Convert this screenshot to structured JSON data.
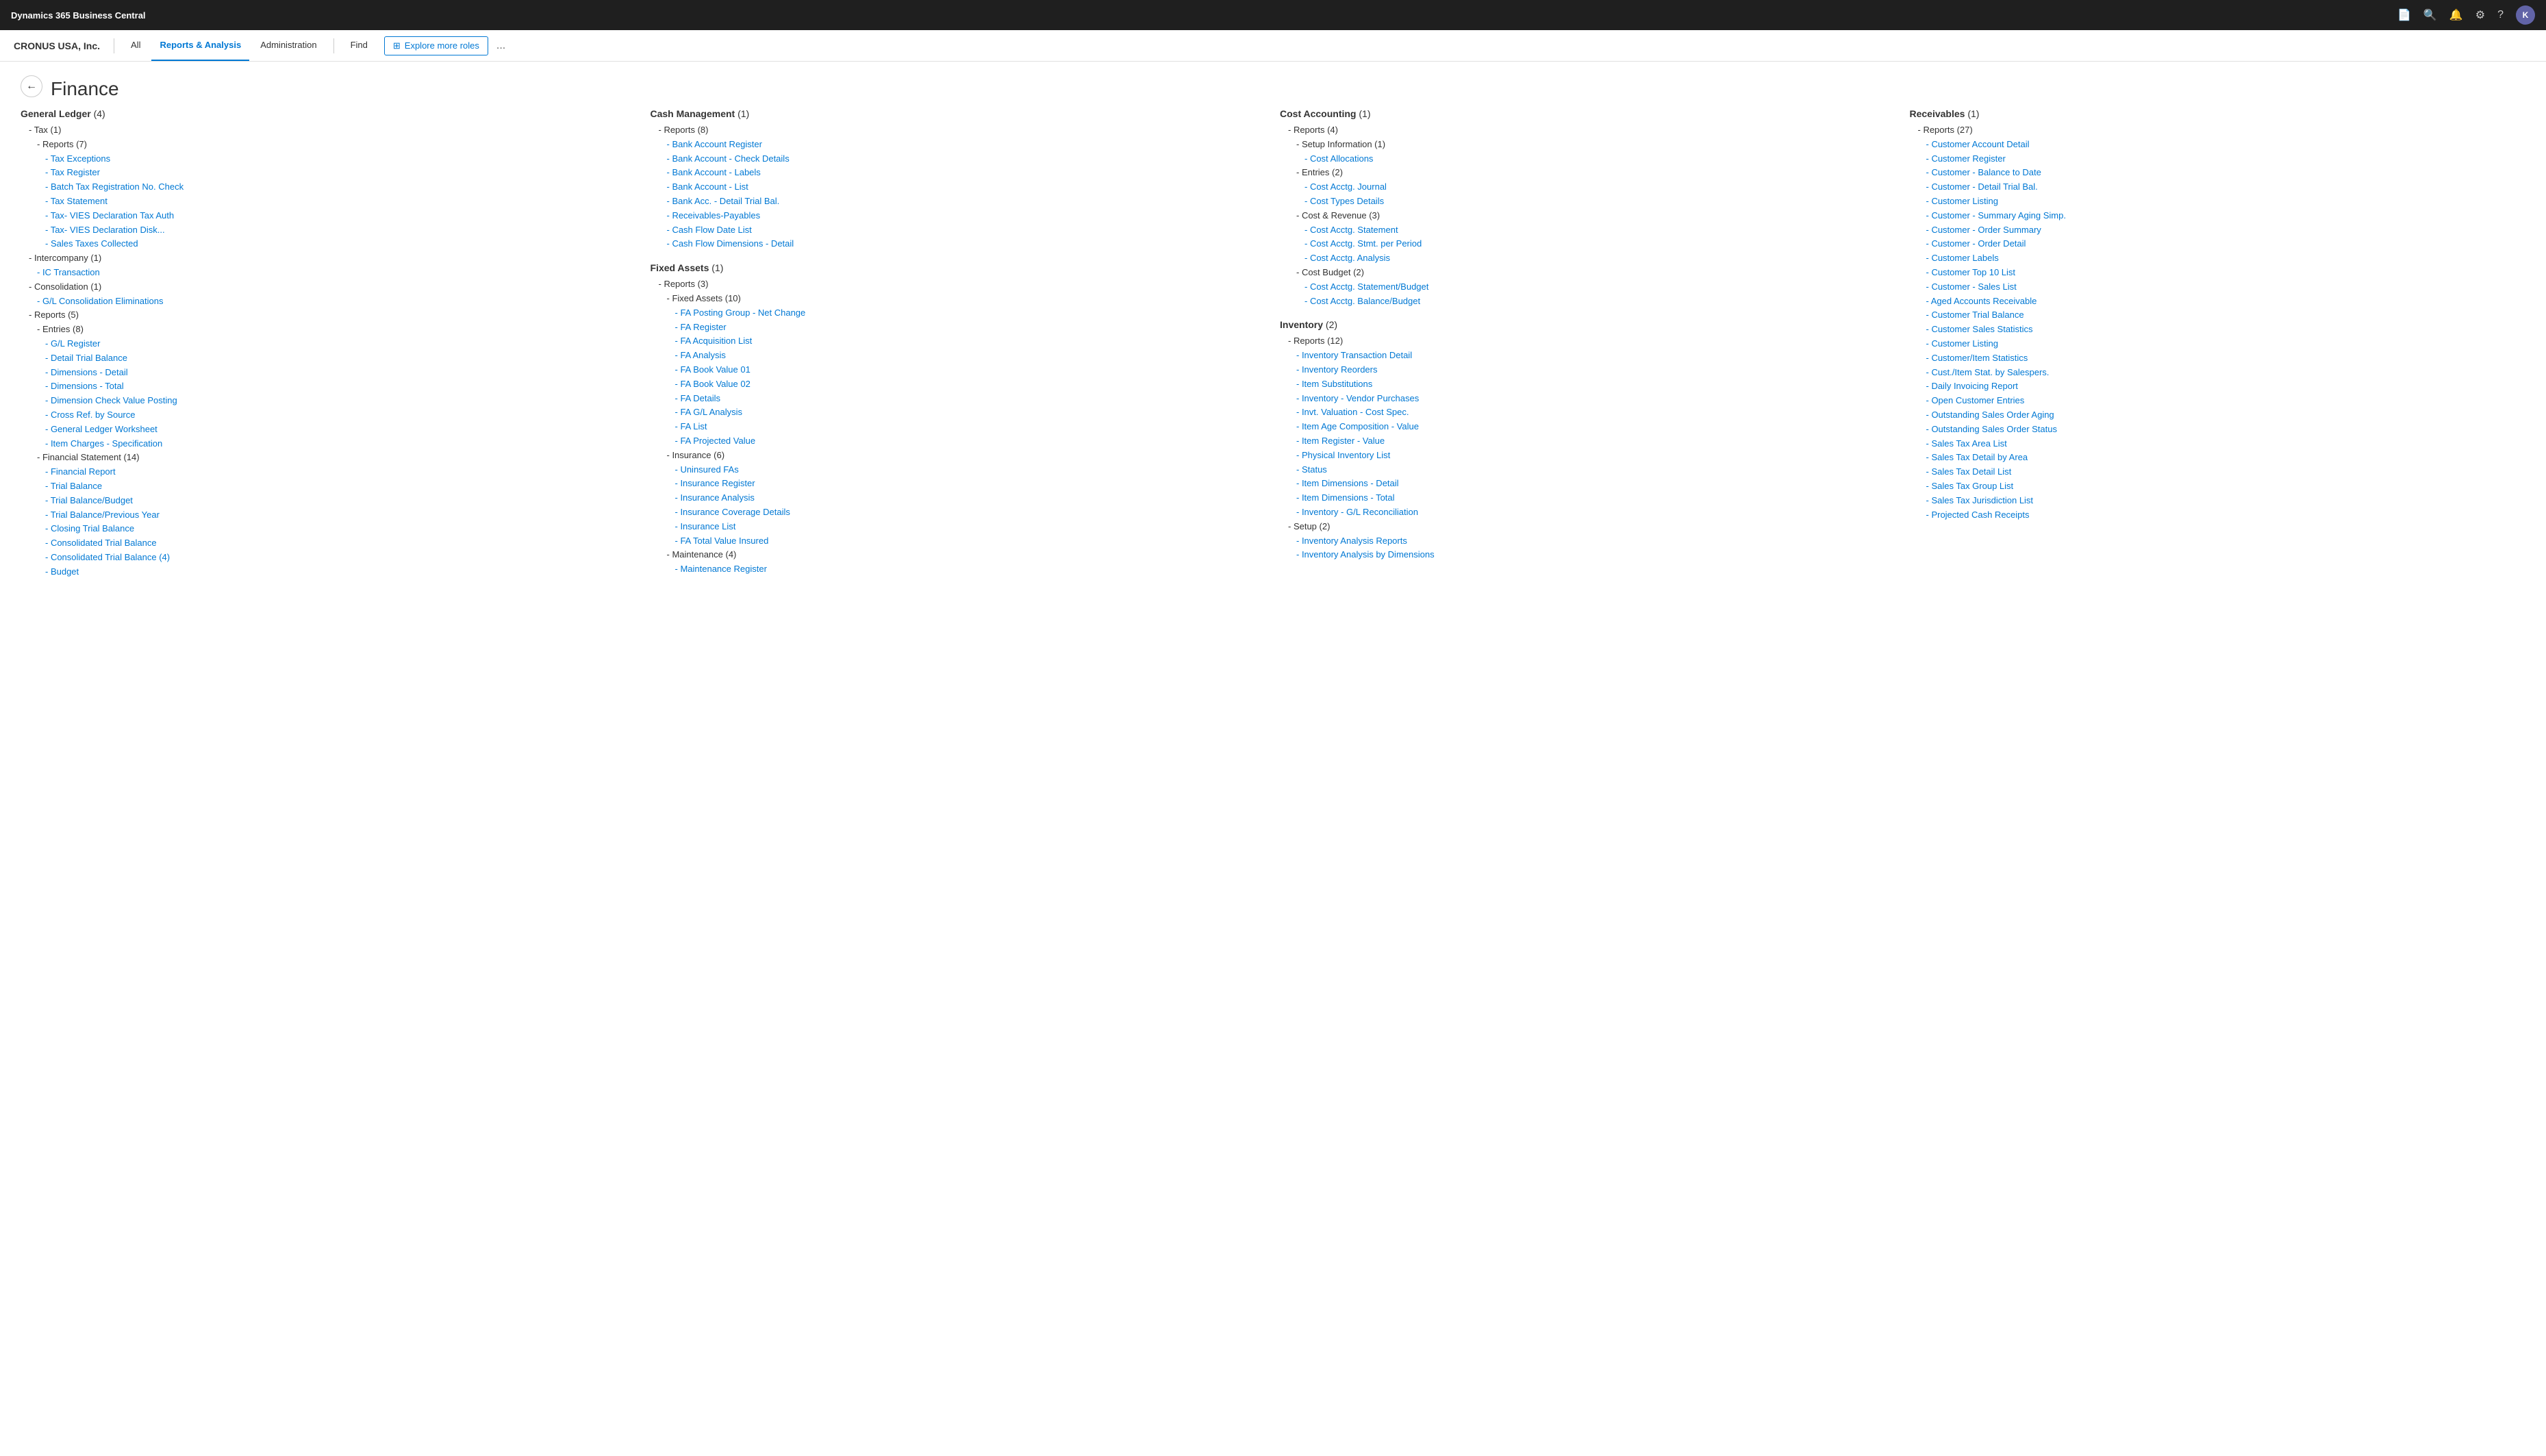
{
  "topbar": {
    "logo": "Dynamics 365 Business Central",
    "avatar_letter": "K"
  },
  "navbar": {
    "company": "CRONUS USA, Inc.",
    "tabs": [
      "All",
      "Reports & Analysis",
      "Administration",
      "Find"
    ],
    "active_tab": "Reports & Analysis",
    "explore_btn": "Explore more roles",
    "more_btn": "..."
  },
  "page": {
    "title": "Finance",
    "back_label": "←"
  },
  "columns": [
    {
      "id": "general-ledger",
      "title": "General Ledger",
      "count": "(4)",
      "items": [
        {
          "level": 1,
          "text": "- Tax (1)",
          "link": false
        },
        {
          "level": 2,
          "text": "- Reports (7)",
          "link": false
        },
        {
          "level": 3,
          "text": "- Tax Exceptions",
          "link": true
        },
        {
          "level": 3,
          "text": "- Tax Register",
          "link": true
        },
        {
          "level": 3,
          "text": "- Batch Tax Registration No. Check",
          "link": true
        },
        {
          "level": 3,
          "text": "- Tax Statement",
          "link": true
        },
        {
          "level": 3,
          "text": "- Tax- VIES Declaration Tax Auth",
          "link": true
        },
        {
          "level": 3,
          "text": "- Tax- VIES Declaration Disk...",
          "link": true
        },
        {
          "level": 3,
          "text": "- Sales Taxes Collected",
          "link": true
        },
        {
          "level": 1,
          "text": "- Intercompany (1)",
          "link": false
        },
        {
          "level": 2,
          "text": "- IC Transaction",
          "link": true
        },
        {
          "level": 1,
          "text": "- Consolidation (1)",
          "link": false
        },
        {
          "level": 2,
          "text": "- G/L Consolidation Eliminations",
          "link": true
        },
        {
          "level": 1,
          "text": "- Reports (5)",
          "link": false
        },
        {
          "level": 2,
          "text": "- Entries (8)",
          "link": false
        },
        {
          "level": 3,
          "text": "- G/L Register",
          "link": true
        },
        {
          "level": 3,
          "text": "- Detail Trial Balance",
          "link": true
        },
        {
          "level": 3,
          "text": "- Dimensions - Detail",
          "link": true
        },
        {
          "level": 3,
          "text": "- Dimensions - Total",
          "link": true
        },
        {
          "level": 3,
          "text": "- Dimension Check Value Posting",
          "link": true
        },
        {
          "level": 3,
          "text": "- Cross Ref. by Source",
          "link": true
        },
        {
          "level": 3,
          "text": "- General Ledger Worksheet",
          "link": true
        },
        {
          "level": 3,
          "text": "- Item Charges - Specification",
          "link": true
        },
        {
          "level": 2,
          "text": "- Financial Statement (14)",
          "link": false
        },
        {
          "level": 3,
          "text": "- Financial Report",
          "link": true
        },
        {
          "level": 3,
          "text": "- Trial Balance",
          "link": true
        },
        {
          "level": 3,
          "text": "- Trial Balance/Budget",
          "link": true
        },
        {
          "level": 3,
          "text": "- Trial Balance/Previous Year",
          "link": true
        },
        {
          "level": 3,
          "text": "- Closing Trial Balance",
          "link": true
        },
        {
          "level": 3,
          "text": "- Consolidated Trial Balance",
          "link": true
        },
        {
          "level": 3,
          "text": "- Consolidated Trial Balance (4)",
          "link": true
        },
        {
          "level": 3,
          "text": "- Budget",
          "link": true
        }
      ]
    },
    {
      "id": "cash-management",
      "title": "Cash Management",
      "count": "(1)",
      "items": [
        {
          "level": 1,
          "text": "- Reports (8)",
          "link": false
        },
        {
          "level": 2,
          "text": "- Bank Account Register",
          "link": true
        },
        {
          "level": 2,
          "text": "- Bank Account - Check Details",
          "link": true
        },
        {
          "level": 2,
          "text": "- Bank Account - Labels",
          "link": true
        },
        {
          "level": 2,
          "text": "- Bank Account - List",
          "link": true
        },
        {
          "level": 2,
          "text": "- Bank Acc. - Detail Trial Bal.",
          "link": true
        },
        {
          "level": 2,
          "text": "- Receivables-Payables",
          "link": true
        },
        {
          "level": 2,
          "text": "- Cash Flow Date List",
          "link": true
        },
        {
          "level": 2,
          "text": "- Cash Flow Dimensions - Detail",
          "link": true
        },
        {
          "level": 0,
          "text": "",
          "link": false
        },
        {
          "level": 0,
          "text": "Fixed Assets (1)",
          "link": false,
          "section": true
        },
        {
          "level": 1,
          "text": "- Reports (3)",
          "link": false
        },
        {
          "level": 2,
          "text": "- Fixed Assets (10)",
          "link": false
        },
        {
          "level": 3,
          "text": "- FA Posting Group - Net Change",
          "link": true
        },
        {
          "level": 3,
          "text": "- FA Register",
          "link": true
        },
        {
          "level": 3,
          "text": "- FA Acquisition List",
          "link": true
        },
        {
          "level": 3,
          "text": "- FA Analysis",
          "link": true
        },
        {
          "level": 3,
          "text": "- FA Book Value 01",
          "link": true
        },
        {
          "level": 3,
          "text": "- FA Book Value 02",
          "link": true
        },
        {
          "level": 3,
          "text": "- FA Details",
          "link": true
        },
        {
          "level": 3,
          "text": "- FA G/L Analysis",
          "link": true
        },
        {
          "level": 3,
          "text": "- FA List",
          "link": true
        },
        {
          "level": 3,
          "text": "- FA Projected Value",
          "link": true
        },
        {
          "level": 2,
          "text": "- Insurance (6)",
          "link": false
        },
        {
          "level": 3,
          "text": "- Uninsured FAs",
          "link": true
        },
        {
          "level": 3,
          "text": "- Insurance Register",
          "link": true
        },
        {
          "level": 3,
          "text": "- Insurance Analysis",
          "link": true
        },
        {
          "level": 3,
          "text": "- Insurance Coverage Details",
          "link": true
        },
        {
          "level": 3,
          "text": "- Insurance List",
          "link": true
        },
        {
          "level": 3,
          "text": "- FA Total Value Insured",
          "link": true
        },
        {
          "level": 2,
          "text": "- Maintenance (4)",
          "link": false
        },
        {
          "level": 3,
          "text": "- Maintenance Register",
          "link": true
        }
      ]
    },
    {
      "id": "cost-accounting",
      "title": "Cost Accounting",
      "count": "(1)",
      "items": [
        {
          "level": 1,
          "text": "- Reports (4)",
          "link": false
        },
        {
          "level": 2,
          "text": "- Setup Information (1)",
          "link": false
        },
        {
          "level": 3,
          "text": "- Cost Allocations",
          "link": true
        },
        {
          "level": 2,
          "text": "- Entries (2)",
          "link": false
        },
        {
          "level": 3,
          "text": "- Cost Acctg. Journal",
          "link": true
        },
        {
          "level": 3,
          "text": "- Cost Types Details",
          "link": true
        },
        {
          "level": 2,
          "text": "- Cost & Revenue (3)",
          "link": false
        },
        {
          "level": 3,
          "text": "- Cost Acctg. Statement",
          "link": true
        },
        {
          "level": 3,
          "text": "- Cost Acctg. Stmt. per Period",
          "link": true
        },
        {
          "level": 3,
          "text": "- Cost Acctg. Analysis",
          "link": true
        },
        {
          "level": 2,
          "text": "- Cost Budget (2)",
          "link": false
        },
        {
          "level": 3,
          "text": "- Cost Acctg. Statement/Budget",
          "link": true
        },
        {
          "level": 3,
          "text": "- Cost Acctg. Balance/Budget",
          "link": true
        },
        {
          "level": 0,
          "text": "",
          "link": false
        },
        {
          "level": 0,
          "text": "Inventory (2)",
          "link": false,
          "section": true
        },
        {
          "level": 1,
          "text": "- Reports (12)",
          "link": false
        },
        {
          "level": 2,
          "text": "- Inventory Transaction Detail",
          "link": true
        },
        {
          "level": 2,
          "text": "- Inventory Reorders",
          "link": true
        },
        {
          "level": 2,
          "text": "- Item Substitutions",
          "link": true
        },
        {
          "level": 2,
          "text": "- Inventory - Vendor Purchases",
          "link": true
        },
        {
          "level": 2,
          "text": "- Invt. Valuation - Cost Spec.",
          "link": true
        },
        {
          "level": 2,
          "text": "- Item Age Composition - Value",
          "link": true
        },
        {
          "level": 2,
          "text": "- Item Register - Value",
          "link": true
        },
        {
          "level": 2,
          "text": "- Physical Inventory List",
          "link": true
        },
        {
          "level": 2,
          "text": "- Status",
          "link": true
        },
        {
          "level": 2,
          "text": "- Item Dimensions - Detail",
          "link": true
        },
        {
          "level": 2,
          "text": "- Item Dimensions - Total",
          "link": true
        },
        {
          "level": 2,
          "text": "- Inventory - G/L Reconciliation",
          "link": true
        },
        {
          "level": 1,
          "text": "- Setup (2)",
          "link": false
        },
        {
          "level": 2,
          "text": "- Inventory Analysis Reports",
          "link": true
        },
        {
          "level": 2,
          "text": "- Inventory Analysis by Dimensions",
          "link": true
        }
      ]
    },
    {
      "id": "receivables",
      "title": "Receivables",
      "count": "(1)",
      "items": [
        {
          "level": 1,
          "text": "- Reports (27)",
          "link": false
        },
        {
          "level": 2,
          "text": "- Customer Account Detail",
          "link": true
        },
        {
          "level": 2,
          "text": "- Customer Register",
          "link": true
        },
        {
          "level": 2,
          "text": "- Customer - Balance to Date",
          "link": true
        },
        {
          "level": 2,
          "text": "- Customer - Detail Trial Bal.",
          "link": true
        },
        {
          "level": 2,
          "text": "- Customer Listing",
          "link": true
        },
        {
          "level": 2,
          "text": "- Customer - Summary Aging Simp.",
          "link": true
        },
        {
          "level": 2,
          "text": "- Customer - Order Summary",
          "link": true
        },
        {
          "level": 2,
          "text": "- Customer - Order Detail",
          "link": true
        },
        {
          "level": 2,
          "text": "- Customer Labels",
          "link": true
        },
        {
          "level": 2,
          "text": "- Customer Top 10 List",
          "link": true
        },
        {
          "level": 2,
          "text": "- Customer - Sales List",
          "link": true
        },
        {
          "level": 2,
          "text": "- Aged Accounts Receivable",
          "link": true
        },
        {
          "level": 2,
          "text": "- Customer Trial Balance",
          "link": true
        },
        {
          "level": 2,
          "text": "- Customer Sales Statistics",
          "link": true
        },
        {
          "level": 2,
          "text": "- Customer Listing",
          "link": true
        },
        {
          "level": 2,
          "text": "- Customer/Item Statistics",
          "link": true
        },
        {
          "level": 2,
          "text": "- Cust./Item Stat. by Salespers.",
          "link": true
        },
        {
          "level": 2,
          "text": "- Daily Invoicing Report",
          "link": true
        },
        {
          "level": 2,
          "text": "- Open Customer Entries",
          "link": true
        },
        {
          "level": 2,
          "text": "- Outstanding Sales Order Aging",
          "link": true
        },
        {
          "level": 2,
          "text": "- Outstanding Sales Order Status",
          "link": true
        },
        {
          "level": 2,
          "text": "- Sales Tax Area List",
          "link": true
        },
        {
          "level": 2,
          "text": "- Sales Tax Detail by Area",
          "link": true
        },
        {
          "level": 2,
          "text": "- Sales Tax Detail List",
          "link": true
        },
        {
          "level": 2,
          "text": "- Sales Tax Group List",
          "link": true
        },
        {
          "level": 2,
          "text": "- Sales Tax Jurisdiction List",
          "link": true
        },
        {
          "level": 2,
          "text": "- Projected Cash Receipts",
          "link": true
        }
      ]
    }
  ]
}
